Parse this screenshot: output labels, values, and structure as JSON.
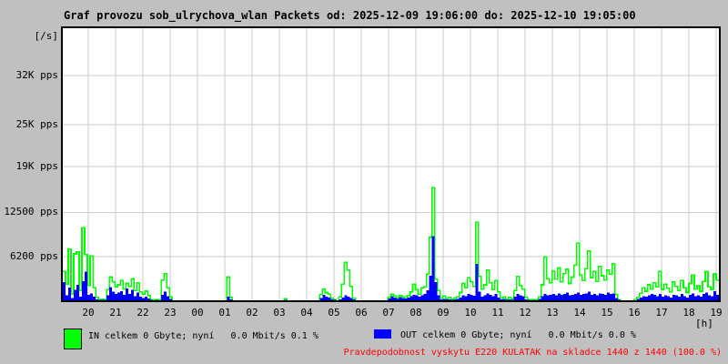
{
  "title": "Graf provozu sob_ulrychova_wlan Packets od: 2025-12-09 19:06:00 do: 2025-12-10 19:05:00",
  "window": {
    "background": "#c0c0c0",
    "plot_background": "#ffffff",
    "grid_color": "#cdcdcd"
  },
  "legend": {
    "in_label": "IN celkem 0 Gbyte; nyní   0.0 Mbit/s 0.1 %",
    "out_label": "OUT celkem 0 Gbyte; nyní   0.0 Mbit/s 0.0 %",
    "in_color": "#00ff00",
    "out_color": "#0000ff"
  },
  "footer": {
    "probability_text": "Pravdepodobnost vyskytu E220 KULATAK na skladce 1440 z 1440 (100.0 %)",
    "color": "#ff0000"
  },
  "chart_data": {
    "type": "area",
    "title": "Graf provozu sob_ulrychova_wlan Packets",
    "time_from": "2025-12-09 19:06:00",
    "time_to": "2025-12-10 19:05:00",
    "ylabel_unit": "[/s]",
    "xlabel_unit": "[h]",
    "ylim": [
      0,
      38700
    ],
    "grid": true,
    "legend_position": "bottom",
    "sample_minutes": 6,
    "y_ticks": [
      {
        "label": "32K pps",
        "value": 32000
      },
      {
        "label": "25K pps",
        "value": 25000
      },
      {
        "label": "19K pps",
        "value": 19000
      },
      {
        "label": "12500 pps",
        "value": 12500
      },
      {
        "label": "6200 pps",
        "value": 6200
      }
    ],
    "x_ticks": [
      "20",
      "21",
      "22",
      "23",
      "00",
      "01",
      "02",
      "03",
      "04",
      "05",
      "06",
      "07",
      "08",
      "09",
      "10",
      "11",
      "12",
      "13",
      "14",
      "15",
      "16",
      "17",
      "18",
      "19"
    ],
    "series": [
      {
        "name": "IN",
        "color": "#00ff00",
        "style": "line",
        "unit": "pps",
        "values": [
          4100,
          2300,
          7300,
          900,
          6600,
          6900,
          1400,
          10300,
          6500,
          2100,
          6300,
          1800,
          400,
          100,
          150,
          100,
          1500,
          3300,
          2600,
          1900,
          2200,
          2800,
          1600,
          2400,
          2000,
          3100,
          1400,
          2500,
          1200,
          900,
          1300,
          700,
          100,
          60,
          80,
          60,
          2900,
          3800,
          1800,
          500,
          0,
          0,
          0,
          0,
          0,
          0,
          0,
          0,
          0,
          0,
          0,
          0,
          0,
          0,
          0,
          0,
          0,
          0,
          0,
          0,
          3300,
          400,
          0,
          0,
          0,
          0,
          0,
          0,
          0,
          0,
          0,
          0,
          0,
          0,
          0,
          0,
          0,
          0,
          0,
          0,
          0,
          250,
          0,
          0,
          0,
          0,
          0,
          0,
          0,
          0,
          0,
          0,
          0,
          0,
          800,
          1600,
          1100,
          900,
          300,
          100,
          0,
          500,
          2300,
          5400,
          4300,
          2000,
          300,
          0,
          0,
          0,
          0,
          0,
          0,
          0,
          0,
          0,
          0,
          0,
          0,
          400,
          900,
          600,
          300,
          700,
          500,
          400,
          700,
          1200,
          2300,
          1500,
          900,
          1800,
          1900,
          3700,
          9000,
          16000,
          3000,
          1400,
          300,
          600,
          200,
          400,
          150,
          300,
          500,
          1100,
          2400,
          1800,
          3200,
          2600,
          2000,
          11100,
          3400,
          1600,
          2200,
          4300,
          2500,
          1500,
          2800,
          1200,
          300,
          500,
          150,
          400,
          200,
          1400,
          3400,
          2100,
          1600,
          400,
          80,
          60,
          100,
          60,
          500,
          2200,
          6200,
          3100,
          2500,
          4200,
          3000,
          4600,
          2600,
          3800,
          4400,
          2400,
          3300,
          5000,
          8100,
          3600,
          2800,
          4500,
          7000,
          3200,
          4100,
          2700,
          4800,
          3500,
          2900,
          4300,
          3700,
          5200,
          800,
          100,
          0,
          0,
          0,
          0,
          0,
          60,
          400,
          1000,
          1800,
          1300,
          2200,
          1600,
          2500,
          1900,
          4100,
          1500,
          2300,
          1700,
          1200,
          2600,
          2000,
          1400,
          2800,
          1800,
          1100,
          2400,
          3600,
          1600,
          2100,
          1300,
          2700,
          4100,
          1900,
          1500,
          3800,
          2900
        ]
      },
      {
        "name": "OUT",
        "color": "#0000ff",
        "style": "area",
        "unit": "pps",
        "values": [
          2600,
          700,
          1800,
          300,
          1500,
          2200,
          500,
          2700,
          4100,
          800,
          1000,
          500,
          150,
          50,
          60,
          40,
          700,
          1900,
          1200,
          900,
          1100,
          1300,
          800,
          1700,
          900,
          1500,
          600,
          1100,
          500,
          300,
          500,
          250,
          50,
          30,
          40,
          30,
          800,
          1200,
          600,
          200,
          0,
          0,
          0,
          0,
          0,
          0,
          0,
          0,
          0,
          0,
          0,
          0,
          0,
          0,
          0,
          0,
          0,
          0,
          0,
          0,
          500,
          150,
          0,
          0,
          0,
          0,
          0,
          0,
          0,
          0,
          0,
          0,
          0,
          0,
          0,
          0,
          0,
          0,
          0,
          0,
          0,
          60,
          0,
          0,
          0,
          0,
          0,
          0,
          0,
          0,
          0,
          0,
          0,
          0,
          350,
          800,
          500,
          400,
          150,
          50,
          0,
          150,
          400,
          700,
          500,
          350,
          100,
          0,
          0,
          0,
          0,
          0,
          0,
          0,
          0,
          0,
          0,
          0,
          0,
          250,
          600,
          400,
          200,
          450,
          300,
          250,
          400,
          600,
          800,
          700,
          500,
          700,
          900,
          1400,
          3500,
          9100,
          2600,
          700,
          150,
          200,
          100,
          150,
          80,
          120,
          200,
          400,
          700,
          600,
          900,
          800,
          650,
          5200,
          1200,
          500,
          700,
          1000,
          800,
          600,
          900,
          400,
          120,
          200,
          70,
          150,
          80,
          500,
          900,
          700,
          600,
          150,
          40,
          30,
          50,
          30,
          200,
          600,
          900,
          700,
          800,
          900,
          700,
          1000,
          800,
          900,
          1100,
          700,
          800,
          900,
          1100,
          800,
          900,
          1000,
          1200,
          800,
          900,
          700,
          1000,
          900,
          800,
          1100,
          900,
          1000,
          300,
          50,
          0,
          0,
          0,
          0,
          0,
          30,
          200,
          400,
          600,
          500,
          700,
          900,
          800,
          600,
          900,
          500,
          700,
          600,
          400,
          800,
          700,
          500,
          900,
          600,
          400,
          800,
          1000,
          600,
          700,
          500,
          900,
          1100,
          700,
          600,
          1300,
          800
        ]
      }
    ]
  }
}
